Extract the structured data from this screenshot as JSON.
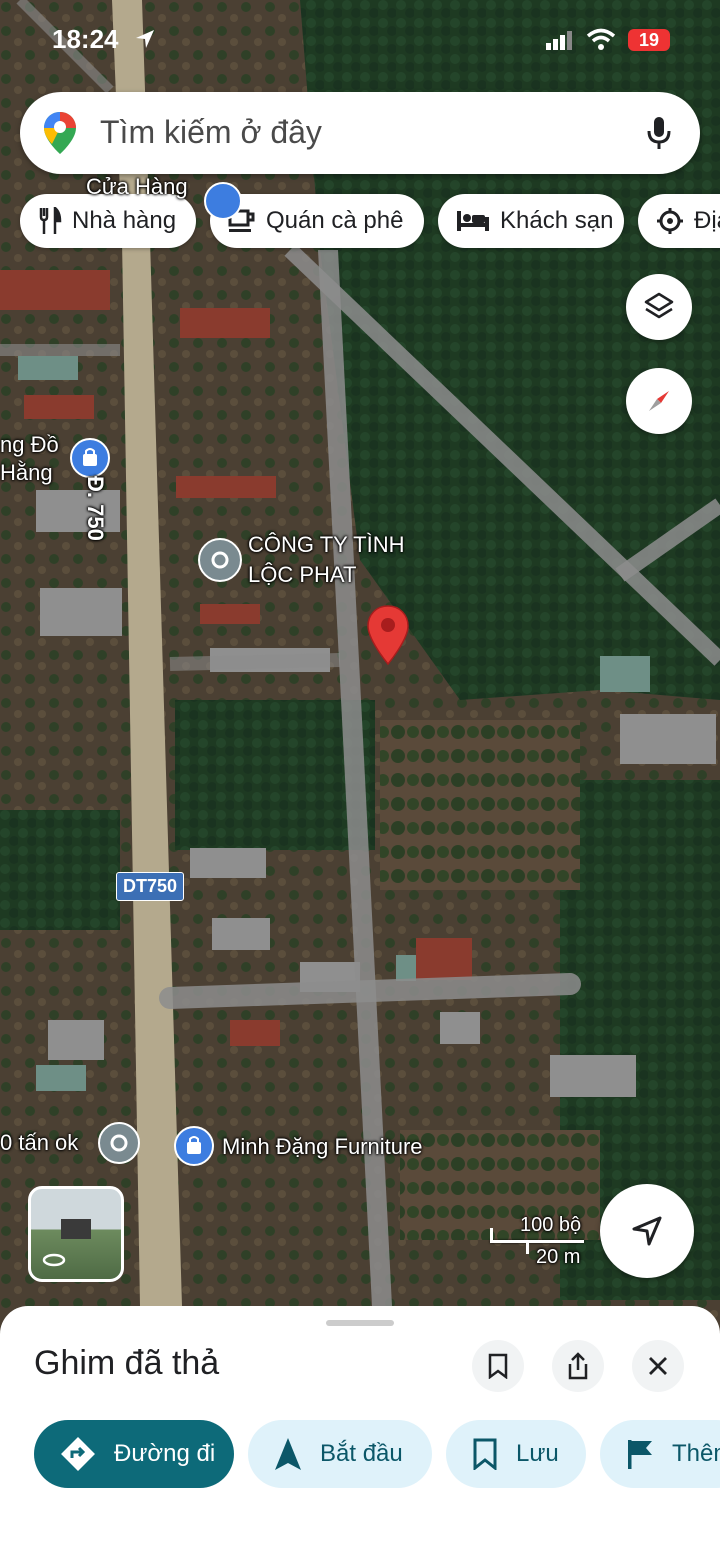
{
  "status_bar": {
    "time": "18:24",
    "battery": "19"
  },
  "search": {
    "placeholder": "Tìm kiếm ở đây"
  },
  "chips": [
    {
      "label": "Nhà hàng",
      "icon": "restaurant-icon"
    },
    {
      "label": "Quán cà phê",
      "icon": "coffee-icon"
    },
    {
      "label": "Khách sạn",
      "icon": "hotel-icon"
    },
    {
      "label": "Địa",
      "icon": "attraction-icon"
    }
  ],
  "map": {
    "labels": {
      "store_top": "Cửa Hàng",
      "store_left_1": "ng Đồ",
      "store_left_2": "Hằng",
      "road_vertical": "Đ. 750",
      "company_1": "CÔNG TY TÌNH",
      "company_2": "LỘC PHAT",
      "road_shield": "DT750",
      "poi_left": "0 tấn ok",
      "furniture": "Minh Đặng Furniture"
    },
    "scale": {
      "feet": "100 bộ",
      "meters": "20 m"
    },
    "colors": {
      "pin": "#e53935",
      "road": "#9a9a9a",
      "shield": "#3c6fb5"
    }
  },
  "sheet": {
    "title": "Ghim đã thả",
    "actions": [
      {
        "label": "Đường đi",
        "icon": "directions-icon"
      },
      {
        "label": "Bắt đầu",
        "icon": "navigate-icon"
      },
      {
        "label": "Lưu",
        "icon": "bookmark-icon"
      },
      {
        "label": "Thêm",
        "icon": "flag-icon"
      }
    ],
    "colors": {
      "primary": "#0d6a79",
      "secondary": "#dff2fa"
    }
  }
}
